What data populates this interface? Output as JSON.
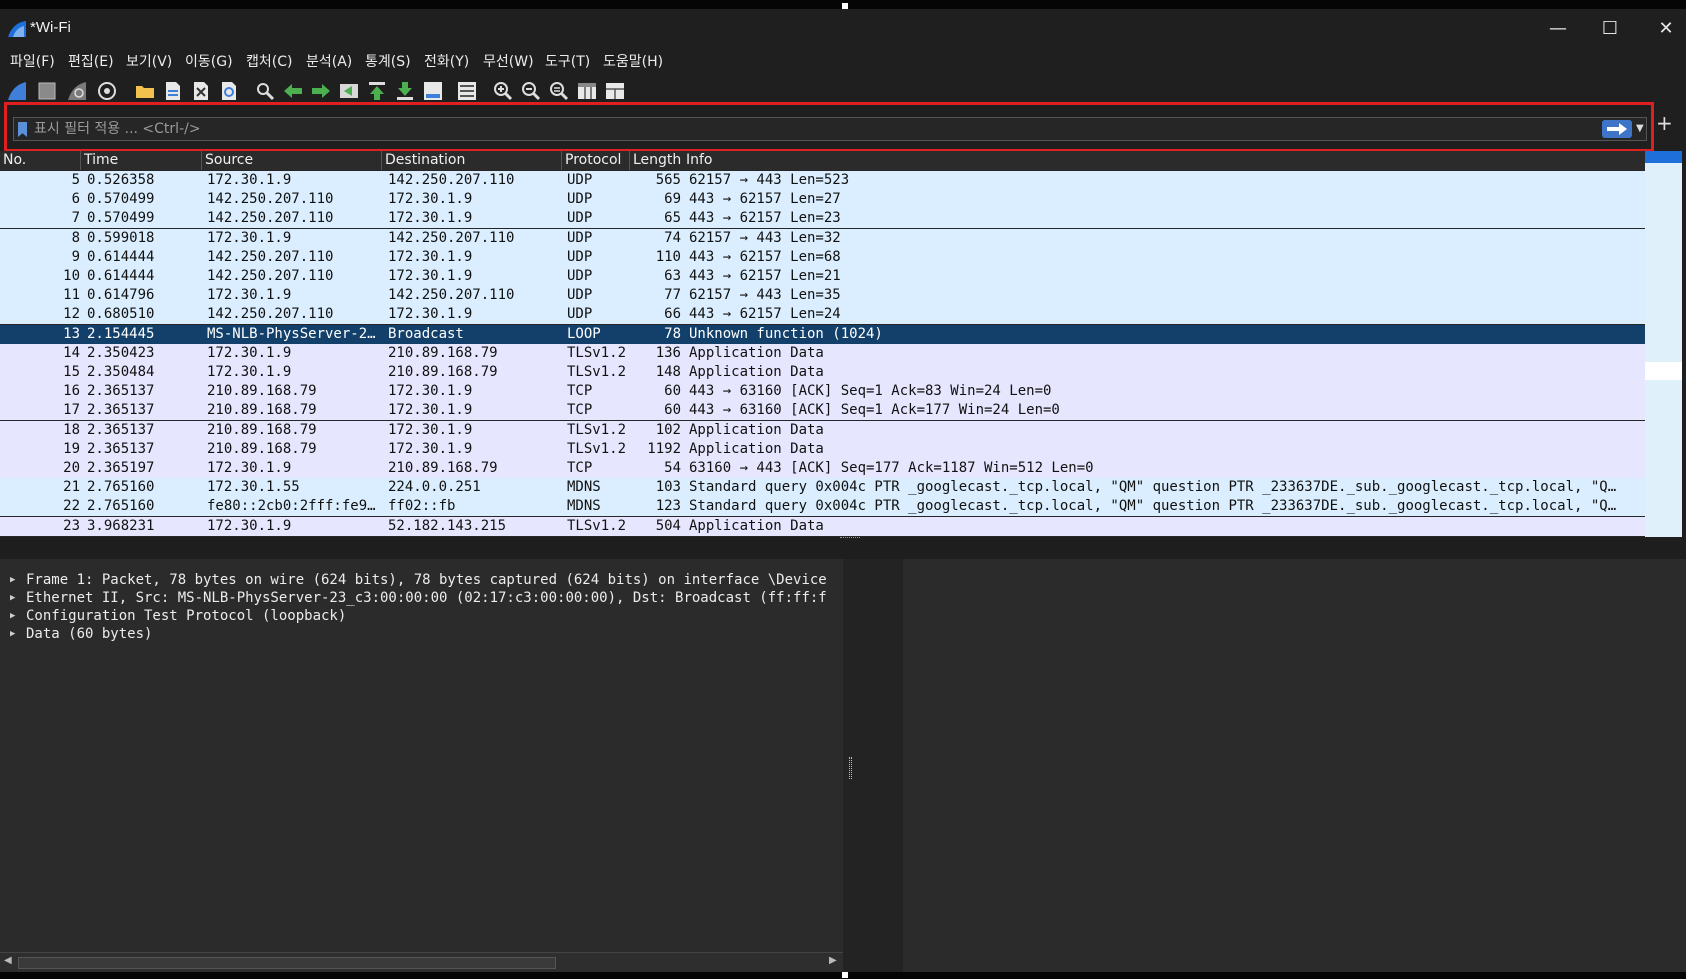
{
  "window": {
    "title": "*Wi-Fi",
    "minimize_glyph": "—",
    "maximize_glyph": "☐",
    "close_glyph": "✕"
  },
  "menu": [
    {
      "label": "파일(F)"
    },
    {
      "label": "편집(E)"
    },
    {
      "label": "보기(V)"
    },
    {
      "label": "이동(G)"
    },
    {
      "label": "캡처(C)"
    },
    {
      "label": "분석(A)"
    },
    {
      "label": "통계(S)"
    },
    {
      "label": "전화(Y)"
    },
    {
      "label": "무선(W)"
    },
    {
      "label": "도구(T)"
    },
    {
      "label": "도움말(H)"
    }
  ],
  "toolbar_icons": [
    "shark-fin-start-icon",
    "stop-square-icon",
    "restart-fin-icon",
    "capture-options-gear-icon",
    "open-folder-icon",
    "save-file-icon",
    "close-file-icon",
    "reload-icon",
    "find-magnifier-icon",
    "go-back-arrow-icon",
    "go-forward-arrow-icon",
    "go-to-packet-icon",
    "first-packet-icon",
    "last-packet-icon",
    "autoscroll-icon",
    "colorize-icon",
    "zoom-in-icon",
    "zoom-out-icon",
    "normal-size-icon",
    "resize-columns-icon",
    "layout-icon"
  ],
  "filter": {
    "placeholder": "표시 필터 적용 ... <Ctrl-/>",
    "value": "",
    "plus_label": "+"
  },
  "colors": {
    "udp_row": "#daeeff",
    "tcp_row": "#e7e6ff",
    "selected_row": "#12406b",
    "selected_text": "#ffffff",
    "highlight_border": "#e02020"
  },
  "packet_list": {
    "columns": [
      "No.",
      "Time",
      "Source",
      "Destination",
      "Protocol",
      "Length",
      "Info"
    ],
    "rows": [
      {
        "no": "5",
        "time": "0.526358",
        "src": "172.30.1.9",
        "dst": "142.250.207.110",
        "proto": "UDP",
        "len": "565",
        "info": "62157 → 443 Len=523",
        "color": "udp"
      },
      {
        "no": "6",
        "time": "0.570499",
        "src": "142.250.207.110",
        "dst": "172.30.1.9",
        "proto": "UDP",
        "len": "69",
        "info": "443 → 62157 Len=27",
        "color": "udp"
      },
      {
        "no": "7",
        "time": "0.570499",
        "src": "142.250.207.110",
        "dst": "172.30.1.9",
        "proto": "UDP",
        "len": "65",
        "info": "443 → 62157 Len=23",
        "color": "udp"
      },
      {
        "no": "8",
        "time": "0.599018",
        "src": "172.30.1.9",
        "dst": "142.250.207.110",
        "proto": "UDP",
        "len": "74",
        "info": "62157 → 443 Len=32",
        "color": "udp"
      },
      {
        "no": "9",
        "time": "0.614444",
        "src": "142.250.207.110",
        "dst": "172.30.1.9",
        "proto": "UDP",
        "len": "110",
        "info": "443 → 62157 Len=68",
        "color": "udp"
      },
      {
        "no": "10",
        "time": "0.614444",
        "src": "142.250.207.110",
        "dst": "172.30.1.9",
        "proto": "UDP",
        "len": "63",
        "info": "443 → 62157 Len=21",
        "color": "udp"
      },
      {
        "no": "11",
        "time": "0.614796",
        "src": "172.30.1.9",
        "dst": "142.250.207.110",
        "proto": "UDP",
        "len": "77",
        "info": "62157 → 443 Len=35",
        "color": "udp"
      },
      {
        "no": "12",
        "time": "0.680510",
        "src": "142.250.207.110",
        "dst": "172.30.1.9",
        "proto": "UDP",
        "len": "66",
        "info": "443 → 62157 Len=24",
        "color": "udp"
      },
      {
        "no": "13",
        "time": "2.154445",
        "src": "MS-NLB-PhysServer-2…",
        "dst": "Broadcast",
        "proto": "LOOP",
        "len": "78",
        "info": "Unknown function (1024)",
        "color": "selected"
      },
      {
        "no": "14",
        "time": "2.350423",
        "src": "172.30.1.9",
        "dst": "210.89.168.79",
        "proto": "TLSv1.2",
        "len": "136",
        "info": "Application Data",
        "color": "tcp"
      },
      {
        "no": "15",
        "time": "2.350484",
        "src": "172.30.1.9",
        "dst": "210.89.168.79",
        "proto": "TLSv1.2",
        "len": "148",
        "info": "Application Data",
        "color": "tcp"
      },
      {
        "no": "16",
        "time": "2.365137",
        "src": "210.89.168.79",
        "dst": "172.30.1.9",
        "proto": "TCP",
        "len": "60",
        "info": "443 → 63160 [ACK] Seq=1 Ack=83 Win=24 Len=0",
        "color": "tcp"
      },
      {
        "no": "17",
        "time": "2.365137",
        "src": "210.89.168.79",
        "dst": "172.30.1.9",
        "proto": "TCP",
        "len": "60",
        "info": "443 → 63160 [ACK] Seq=1 Ack=177 Win=24 Len=0",
        "color": "tcp"
      },
      {
        "no": "18",
        "time": "2.365137",
        "src": "210.89.168.79",
        "dst": "172.30.1.9",
        "proto": "TLSv1.2",
        "len": "102",
        "info": "Application Data",
        "color": "tcp"
      },
      {
        "no": "19",
        "time": "2.365137",
        "src": "210.89.168.79",
        "dst": "172.30.1.9",
        "proto": "TLSv1.2",
        "len": "1192",
        "info": "Application Data",
        "color": "tcp"
      },
      {
        "no": "20",
        "time": "2.365197",
        "src": "172.30.1.9",
        "dst": "210.89.168.79",
        "proto": "TCP",
        "len": "54",
        "info": "63160 → 443 [ACK] Seq=177 Ack=1187 Win=512 Len=0",
        "color": "tcp"
      },
      {
        "no": "21",
        "time": "2.765160",
        "src": "172.30.1.55",
        "dst": "224.0.0.251",
        "proto": "MDNS",
        "len": "103",
        "info": "Standard query 0x004c PTR _googlecast._tcp.local, \"QM\" question PTR _233637DE._sub._googlecast._tcp.local, \"Q…",
        "color": "udp"
      },
      {
        "no": "22",
        "time": "2.765160",
        "src": "fe80::2cb0:2fff:fe9…",
        "dst": "ff02::fb",
        "proto": "MDNS",
        "len": "123",
        "info": "Standard query 0x004c PTR _googlecast._tcp.local, \"QM\" question PTR _233637DE._sub._googlecast._tcp.local, \"Q…",
        "color": "udp"
      },
      {
        "no": "23",
        "time": "3.968231",
        "src": "172.30.1.9",
        "dst": "52.182.143.215",
        "proto": "TLSv1.2",
        "len": "504",
        "info": "Application Data",
        "color": "tcp"
      }
    ]
  },
  "details": [
    {
      "text": "Frame 1: Packet, 78 bytes on wire (624 bits), 78 bytes captured (624 bits) on interface \\Device"
    },
    {
      "text": "Ethernet II, Src: MS-NLB-PhysServer-23_c3:00:00:00 (02:17:c3:00:00:00), Dst: Broadcast (ff:ff:f"
    },
    {
      "text": "Configuration Test Protocol (loopback)"
    },
    {
      "text": "Data (60 bytes)"
    }
  ]
}
